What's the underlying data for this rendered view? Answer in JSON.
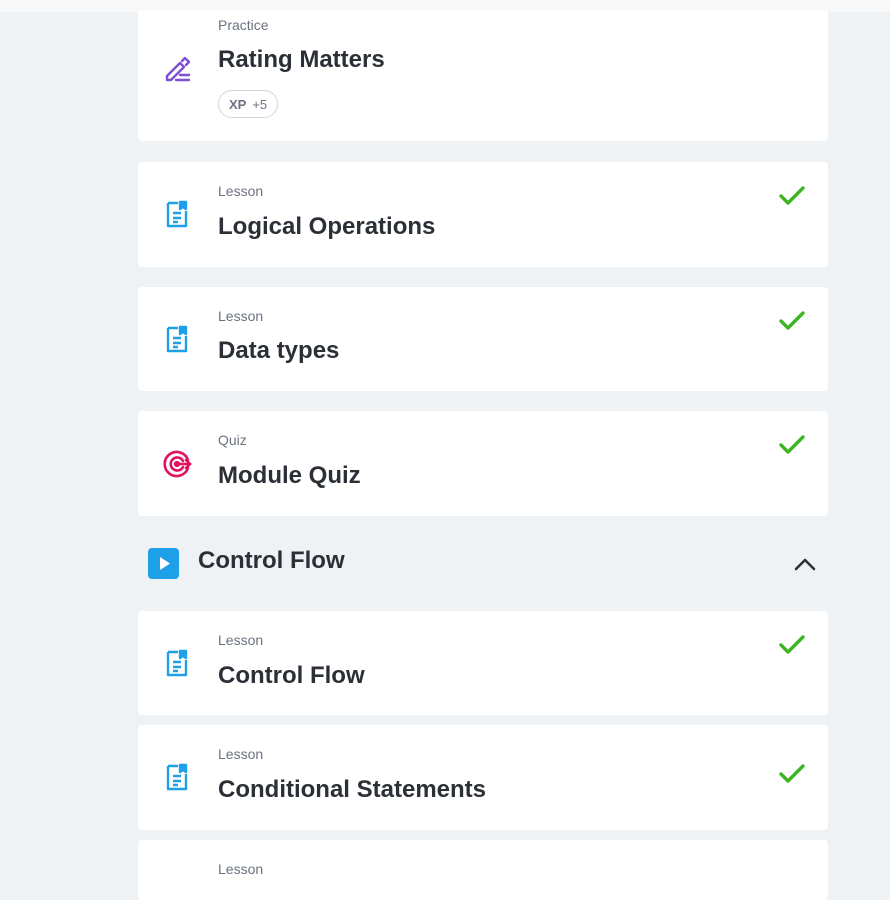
{
  "items_top": [
    {
      "type": "Practice",
      "title": "Rating Matters",
      "icon": "edit-pencil-icon",
      "xp_label": "XP",
      "xp_value": "+5",
      "completed": false
    },
    {
      "type": "Lesson",
      "title": "Logical Operations",
      "icon": "lesson-document-icon",
      "completed": true
    },
    {
      "type": "Lesson",
      "title": "Data types",
      "icon": "lesson-document-icon",
      "completed": true
    },
    {
      "type": "Quiz",
      "title": "Module Quiz",
      "icon": "target-icon",
      "completed": true
    }
  ],
  "section": {
    "title": "Control Flow",
    "icon": "play-icon",
    "expanded": true,
    "toggle_icon": "chevron-up-icon"
  },
  "items_section": [
    {
      "type": "Lesson",
      "title": "Control Flow",
      "icon": "lesson-document-icon",
      "completed": true
    },
    {
      "type": "Lesson",
      "title": "Conditional Statements",
      "icon": "lesson-document-icon",
      "completed": true
    },
    {
      "type": "Lesson",
      "title": "",
      "icon": "lesson-document-icon",
      "completed": false
    }
  ],
  "colors": {
    "background": "#eff2f5",
    "card": "#ffffff",
    "lesson_icon": "#1ea0e8",
    "practice_icon": "#7b4fd6",
    "quiz_icon": "#e0115f",
    "check": "#3cb521",
    "play_button": "#1ea0e8",
    "title_text": "#2b2f36",
    "meta_text": "#6b7280"
  }
}
